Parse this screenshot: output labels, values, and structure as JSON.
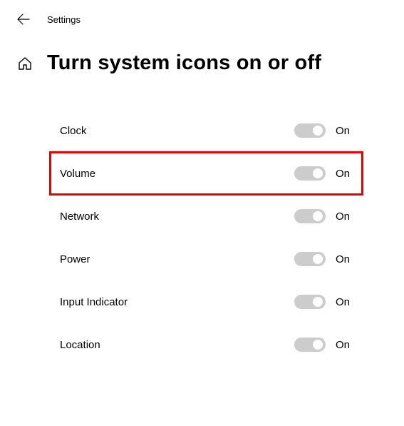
{
  "header": {
    "title": "Settings"
  },
  "page": {
    "title": "Turn system icons on or off"
  },
  "settings": [
    {
      "label": "Clock",
      "state": "On",
      "highlighted": false
    },
    {
      "label": "Volume",
      "state": "On",
      "highlighted": true
    },
    {
      "label": "Network",
      "state": "On",
      "highlighted": false
    },
    {
      "label": "Power",
      "state": "On",
      "highlighted": false
    },
    {
      "label": "Input Indicator",
      "state": "On",
      "highlighted": false
    },
    {
      "label": "Location",
      "state": "On",
      "highlighted": false
    }
  ]
}
